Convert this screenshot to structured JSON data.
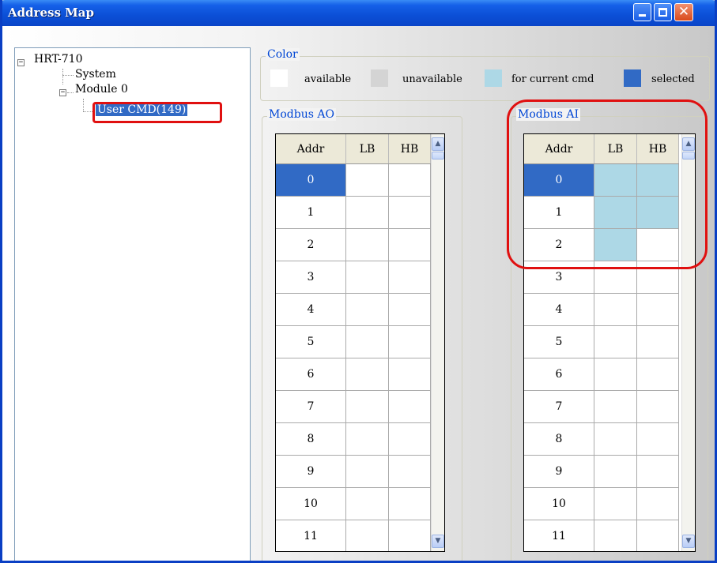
{
  "window": {
    "title": "Address Map",
    "minimize": "",
    "maximize": "",
    "close": "✕"
  },
  "tree": {
    "root": "HRT-710",
    "system": "System",
    "module": "Module 0",
    "user_cmd": "User CMD(149)",
    "expand_glyph": "−"
  },
  "color_group": {
    "label": "Color",
    "available": "available",
    "unavailable": "unavailable",
    "current": "for current cmd",
    "selected": "selected",
    "colors": {
      "available": "#ffffff",
      "unavailable": "#d4d4d4",
      "current": "#add8e6",
      "selected": "#316ac5"
    }
  },
  "modbus_ao": {
    "label": "Modbus AO",
    "headers": [
      "Addr",
      "LB",
      "HB"
    ],
    "rows": [
      "0",
      "1",
      "2",
      "3",
      "4",
      "5",
      "6",
      "7",
      "8",
      "9",
      "10",
      "11"
    ]
  },
  "modbus_ai": {
    "label": "Modbus AI",
    "headers": [
      "Addr",
      "LB",
      "HB"
    ],
    "rows": [
      "0",
      "1",
      "2",
      "3",
      "4",
      "5",
      "6",
      "7",
      "8",
      "9",
      "10",
      "11"
    ]
  },
  "scroll": {
    "up": "▲",
    "down": "▼"
  }
}
